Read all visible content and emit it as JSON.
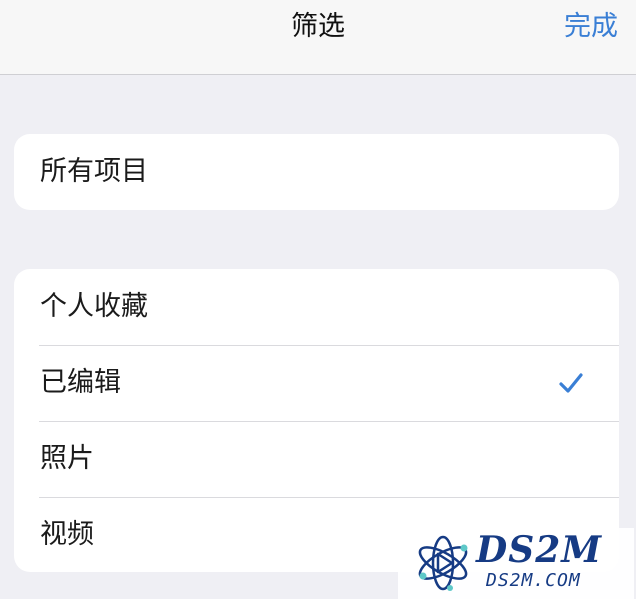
{
  "nav": {
    "title": "筛选",
    "done_label": "完成"
  },
  "colors": {
    "accent": "#3a7fd5",
    "background": "#efeff4",
    "card": "#ffffff",
    "watermark_brand": "#163b84"
  },
  "sections": {
    "all": {
      "label": "所有项目"
    },
    "filters": [
      {
        "label": "个人收藏",
        "selected": false
      },
      {
        "label": "已编辑",
        "selected": true
      },
      {
        "label": "照片",
        "selected": false
      },
      {
        "label": "视频",
        "selected": false
      }
    ]
  },
  "watermark": {
    "title": "DS2M",
    "subtitle": "DS2M.COM",
    "icon": "atom-play-logo"
  }
}
